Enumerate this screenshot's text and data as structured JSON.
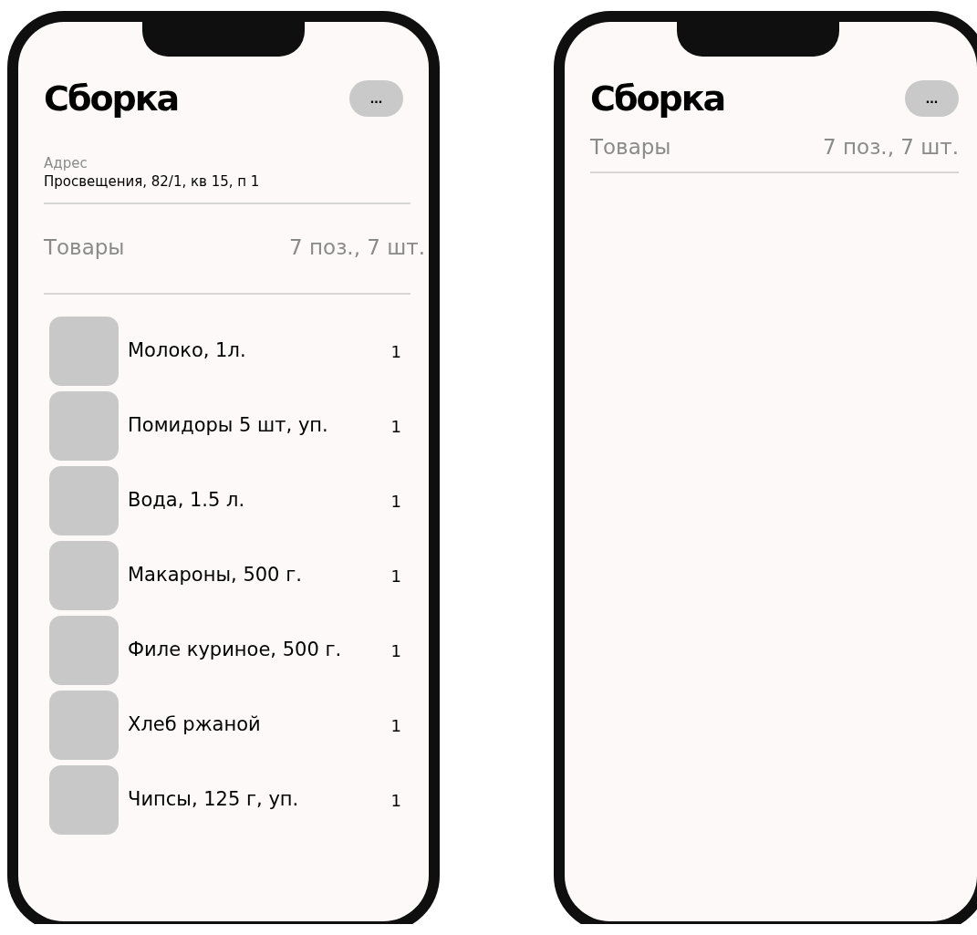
{
  "phones": [
    {
      "title": "Сборка",
      "menu_button": "...",
      "address": {
        "label": "Адрес",
        "value": "Просвещения, 82/1, кв 15, п 1"
      },
      "summary": {
        "label": "Товары",
        "value": "7 поз., 7 шт."
      },
      "items": [
        {
          "name": "Молоко, 1л.",
          "qty": "1"
        },
        {
          "name": "Помидоры 5 шт, уп.",
          "qty": "1"
        },
        {
          "name": "Вода, 1.5 л.",
          "qty": "1"
        },
        {
          "name": "Макароны, 500 г.",
          "qty": "1"
        },
        {
          "name": "Филе куриное, 500 г.",
          "qty": "1"
        },
        {
          "name": "Хлеб ржаной",
          "qty": "1"
        },
        {
          "name": "Чипсы, 125 г, уп.",
          "qty": "1"
        }
      ]
    },
    {
      "title": "Сборка",
      "menu_button": "...",
      "summary": {
        "label": "Товары",
        "value": "7 поз., 7 шт."
      }
    }
  ]
}
